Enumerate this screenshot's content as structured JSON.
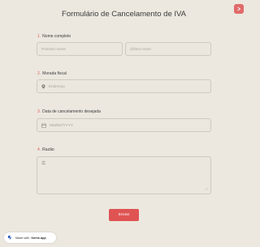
{
  "form": {
    "title": "Formulário de Cancelamento de IVA",
    "fields": [
      {
        "number": "1.",
        "label": "Nome completo",
        "placeholders": [
          "Primeiro nome",
          "Último nome"
        ]
      },
      {
        "number": "2.",
        "label": "Morada fiscal",
        "placeholder": "Endereço",
        "icon": "location-pin-icon"
      },
      {
        "number": "3.",
        "label": "Data de cancelamento desejada",
        "placeholder": "MM/DD/YYYY",
        "icon": "calendar-icon"
      },
      {
        "number": "4.",
        "label": "Razão",
        "value": "",
        "icon": "text-lines-icon"
      }
    ],
    "submit_label": "Enviar"
  },
  "badge": {
    "prefix": "Made with",
    "brand": "forms.app"
  },
  "colors": {
    "accent": "#df5353",
    "background": "#ece8df"
  }
}
